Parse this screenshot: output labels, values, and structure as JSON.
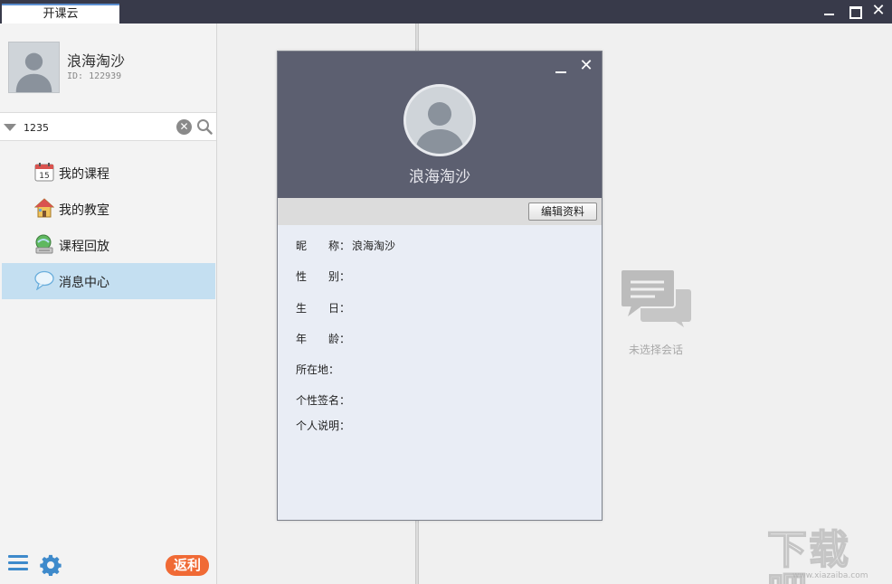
{
  "window": {
    "tab_title": "开课云",
    "minimize_icon": "minimize-icon",
    "maximize_icon": "maximize-icon",
    "close_icon": "close-icon",
    "close_glyph": "✕"
  },
  "sidebar": {
    "profile": {
      "name": "浪海淘沙",
      "id_text": "ID: 122939"
    },
    "search": {
      "value": "1235",
      "clear_glyph": "✕"
    },
    "nav": [
      {
        "label": "我的课程",
        "icon": "calendar-icon"
      },
      {
        "label": "我的教室",
        "icon": "house-icon"
      },
      {
        "label": "课程回放",
        "icon": "playback-icon"
      },
      {
        "label": "消息中心",
        "icon": "chat-bubble-icon",
        "active": true
      }
    ],
    "footer": {
      "menu_icon": "menu-icon",
      "settings_icon": "gear-icon",
      "badge_label": "返利"
    }
  },
  "main": {
    "empty_text": "未选择会话"
  },
  "dialog": {
    "close_glyph": "✕",
    "name": "浪海淘沙",
    "edit_button": "编辑资料",
    "fields": [
      {
        "label": "昵　　称：",
        "value": "浪海淘沙"
      },
      {
        "label": "性　　别：",
        "value": ""
      },
      {
        "label": "生　　日：",
        "value": ""
      },
      {
        "label": "年　　龄：",
        "value": ""
      },
      {
        "label": "所在地：",
        "value": ""
      },
      {
        "label": "个性签名：",
        "value": ""
      },
      {
        "label": "个人说明：",
        "value": ""
      }
    ]
  },
  "watermark": {
    "text": "下载吧",
    "url": "www.xiazaiba.com"
  },
  "colors": {
    "titlebar": "#383a4a",
    "dialog_header": "#5c5f70",
    "active_nav": "#c4dff1",
    "accent_blue": "#3e8acb",
    "badge": "#f06a35"
  }
}
